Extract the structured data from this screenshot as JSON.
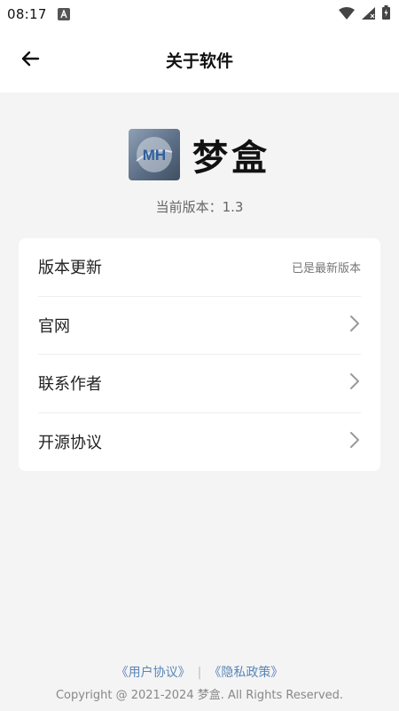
{
  "status_bar": {
    "time": "08:17",
    "icons": [
      "notification-a-icon",
      "wifi-icon",
      "signal-icon",
      "battery-charging-icon"
    ]
  },
  "header": {
    "title": "关于软件",
    "back_icon": "arrow-left-icon"
  },
  "app": {
    "logo_text": "MH",
    "name": "梦盒",
    "version_line": "当前版本：1.3"
  },
  "menu": {
    "items": [
      {
        "label": "版本更新",
        "value": "已是最新版本"
      },
      {
        "label": "官网"
      },
      {
        "label": "联系作者"
      },
      {
        "label": "开源协议"
      }
    ]
  },
  "footer": {
    "user_agreement": "《用户协议》",
    "separator": "|",
    "privacy_policy": "《隐私政策》",
    "copyright": "Copyright @ 2021-2024 梦盒. All Rights Reserved."
  },
  "colors": {
    "background": "#f4f4f4",
    "card": "#ffffff",
    "link": "#5a86b8"
  }
}
